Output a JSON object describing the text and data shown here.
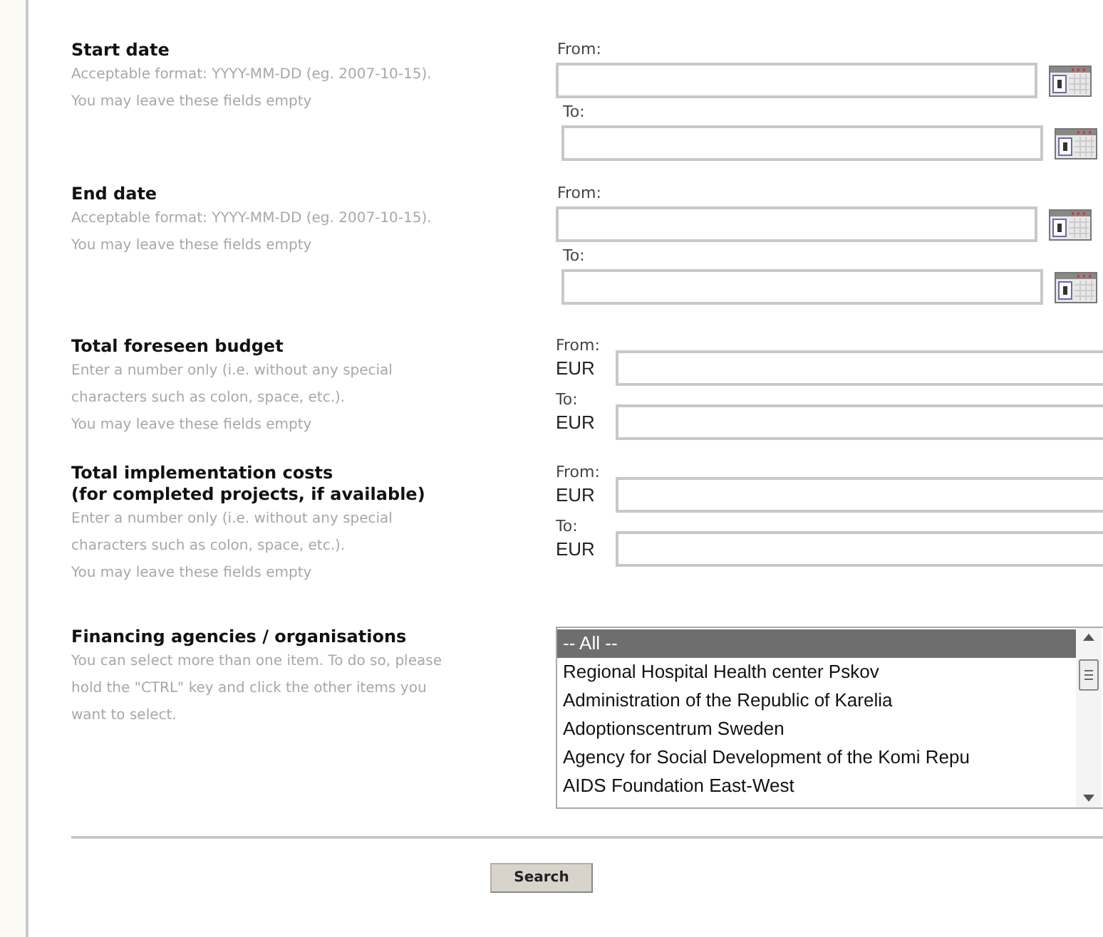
{
  "sections": [
    {
      "kind": "date",
      "title": [
        "Start date"
      ],
      "notes": [
        "Acceptable format: YYYY-MM-DD (eg. 2007-10-15).",
        "You may leave these fields empty"
      ],
      "fields": [
        {
          "label": "From:"
        },
        {
          "label": "To:"
        }
      ]
    },
    {
      "kind": "date",
      "title": [
        "End date"
      ],
      "notes": [
        "Acceptable format: YYYY-MM-DD (eg. 2007-10-15).",
        "You may leave these fields empty"
      ],
      "fields": [
        {
          "label": "From:"
        },
        {
          "label": "To:"
        }
      ]
    },
    {
      "kind": "money",
      "title": [
        "Total foreseen budget"
      ],
      "notes": [
        "Enter a number only (i.e. without any special characters such as colon, space, etc.).",
        "You may leave these fields empty"
      ],
      "fields": [
        {
          "label": "From:",
          "currency": "EUR"
        },
        {
          "label": "To:",
          "currency": "EUR"
        }
      ]
    },
    {
      "kind": "money",
      "title": [
        "Total implementation costs",
        "(for completed projects, if available)"
      ],
      "notes": [
        "Enter a number only (i.e. without any special characters such as colon, space, etc.).",
        "You may leave these fields empty"
      ],
      "fields": [
        {
          "label": "From:",
          "currency": "EUR"
        },
        {
          "label": "To:",
          "currency": "EUR"
        }
      ]
    },
    {
      "kind": "list",
      "title": [
        "Financing agencies / organisations"
      ],
      "notes": [
        "You can select more than one item. To do so, please hold the \"CTRL\" key and click the other items you want to select."
      ],
      "options": [
        {
          "label": "-- All --",
          "selected": true
        },
        {
          "label": "Regional Hospital Health center Pskov",
          "selected": false
        },
        {
          "label": "Administration of the Republic of Karelia",
          "selected": false
        },
        {
          "label": "Adoptionscentrum Sweden",
          "selected": false
        },
        {
          "label": "Agency for Social Development of the Komi Repu",
          "selected": false
        },
        {
          "label": "AIDS Foundation East-West",
          "selected": false
        }
      ]
    }
  ],
  "search_button": "Search"
}
